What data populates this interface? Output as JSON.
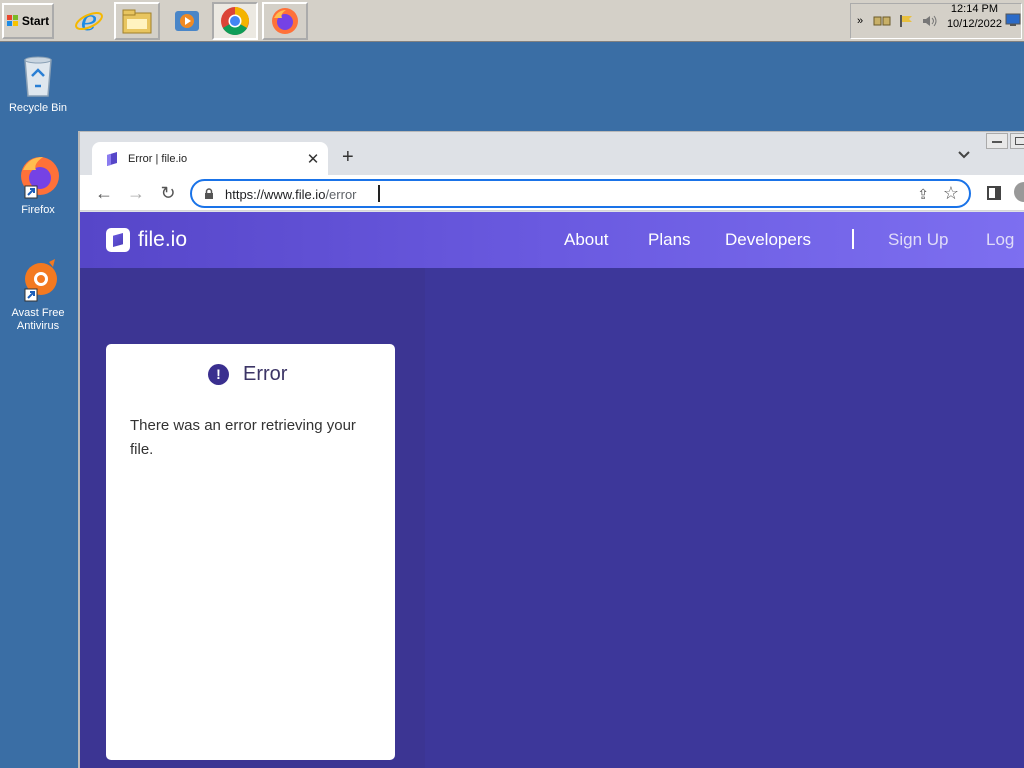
{
  "taskbar": {
    "start_label": "Start",
    "clock_time": "12:14 PM",
    "clock_date": "10/12/2022",
    "tray_chevron": "»"
  },
  "desktop": {
    "icons": [
      {
        "label": "Recycle Bin"
      },
      {
        "label": "Firefox"
      },
      {
        "label": "Avast Free Antivirus"
      }
    ]
  },
  "browser": {
    "tab_title": "Error | file.io",
    "tab_close": "✕",
    "new_tab": "+",
    "tab_menu": "⌄",
    "url_host": "https://www.file.io",
    "url_path": "/error",
    "back": "←",
    "forward": "→",
    "reload": "↻",
    "share": "⇪",
    "star": "☆"
  },
  "site": {
    "logo": "file.io",
    "nav": [
      "About",
      "Plans",
      "Developers",
      "Sign Up",
      "Log"
    ]
  },
  "error_card": {
    "icon": "!",
    "title": "Error",
    "message": "There was an error retrieving your file."
  },
  "colors": {
    "desktop": "#3a6ea5",
    "page_bg": "#3c3593",
    "header_start": "#5646c8",
    "header_end": "#7d6ff0",
    "accent": "#1a73e8"
  }
}
